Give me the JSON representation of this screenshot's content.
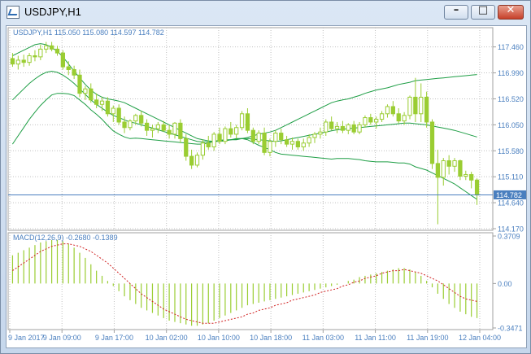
{
  "window": {
    "title": "USDJPY,H1",
    "buttons": {
      "minimize": "–",
      "maximize": "□",
      "close": "✕"
    }
  },
  "chart": {
    "info_label": "USDJPY,H1  115.050 115.080 114.597 114.782",
    "price_axis": [
      "117.460",
      "116.990",
      "116.520",
      "116.050",
      "115.580",
      "115.110",
      "114.640",
      "114.170"
    ],
    "current_price": "114.782",
    "time_axis": [
      "9 Jan 2017",
      "9 Jan 09:00",
      "9 Jan 17:00",
      "10 Jan 02:00",
      "10 Jan 10:00",
      "10 Jan 18:00",
      "11 Jan 03:00",
      "11 Jan 11:00",
      "11 Jan 19:00",
      "12 Jan 04:00"
    ],
    "macd_label": "MACD(12,26,9) -0.2680 -0.1389",
    "macd_axis": [
      "0.3709",
      "0.00",
      "-0.3471"
    ]
  },
  "colors": {
    "candle": "#9acd32",
    "bands": "#1e9e45",
    "grid": "#c0c0c0",
    "axis_text": "#4a7fbf",
    "macd_signal": "#d02020",
    "current_price_line": "#4a7fbf"
  },
  "chart_data": [
    {
      "type": "candlestick",
      "title": "USDJPY,H1",
      "ylim": [
        114.17,
        117.7
      ],
      "x": [
        "9 Jan 2017",
        "9 Jan 09:00",
        "9 Jan 17:00",
        "10 Jan 02:00",
        "10 Jan 10:00",
        "10 Jan 18:00",
        "11 Jan 03:00",
        "11 Jan 11:00",
        "11 Jan 19:00",
        "12 Jan 04:00"
      ],
      "ohlc": [
        [
          117.25,
          117.35,
          117.1,
          117.15
        ],
        [
          117.15,
          117.3,
          117.05,
          117.22
        ],
        [
          117.22,
          117.32,
          117.1,
          117.18
        ],
        [
          117.18,
          117.35,
          117.12,
          117.3
        ],
        [
          117.3,
          117.4,
          117.2,
          117.28
        ],
        [
          117.28,
          117.5,
          117.22,
          117.42
        ],
        [
          117.42,
          117.55,
          117.35,
          117.48
        ],
        [
          117.48,
          117.55,
          117.38,
          117.42
        ],
        [
          117.42,
          117.48,
          117.3,
          117.35
        ],
        [
          117.35,
          117.4,
          117.05,
          117.1
        ],
        [
          117.1,
          117.2,
          116.95,
          117.05
        ],
        [
          117.05,
          117.12,
          116.88,
          116.95
        ],
        [
          116.95,
          117.05,
          116.55,
          116.62
        ],
        [
          116.62,
          116.75,
          116.5,
          116.7
        ],
        [
          116.7,
          116.8,
          116.45,
          116.5
        ],
        [
          116.5,
          116.62,
          116.35,
          116.42
        ],
        [
          116.42,
          116.55,
          116.3,
          116.48
        ],
        [
          116.48,
          116.55,
          116.2,
          116.25
        ],
        [
          116.25,
          116.4,
          116.1,
          116.35
        ],
        [
          116.35,
          116.42,
          116.05,
          116.1
        ],
        [
          116.1,
          116.2,
          115.9,
          116.0
        ],
        [
          116.0,
          116.15,
          115.95,
          116.12
        ],
        [
          116.12,
          116.25,
          116.05,
          116.22
        ],
        [
          116.22,
          116.3,
          116.02,
          116.08
        ],
        [
          116.08,
          116.15,
          115.85,
          115.95
        ],
        [
          115.95,
          116.05,
          115.82,
          115.98
        ],
        [
          115.98,
          116.1,
          115.9,
          116.05
        ],
        [
          116.05,
          116.12,
          115.92,
          115.95
        ],
        [
          115.95,
          116.05,
          115.8,
          115.88
        ],
        [
          115.88,
          116.1,
          115.8,
          116.08
        ],
        [
          116.08,
          116.15,
          115.72,
          115.8
        ],
        [
          115.8,
          115.88,
          115.4,
          115.48
        ],
        [
          115.48,
          115.6,
          115.25,
          115.32
        ],
        [
          115.32,
          115.55,
          115.28,
          115.5
        ],
        [
          115.5,
          115.78,
          115.42,
          115.72
        ],
        [
          115.72,
          115.85,
          115.6,
          115.65
        ],
        [
          115.65,
          115.92,
          115.58,
          115.88
        ],
        [
          115.88,
          116.0,
          115.7,
          115.75
        ],
        [
          115.75,
          116.02,
          115.7,
          115.98
        ],
        [
          115.98,
          116.1,
          115.82,
          115.88
        ],
        [
          115.88,
          116.05,
          115.8,
          116.0
        ],
        [
          116.0,
          116.3,
          115.95,
          116.25
        ],
        [
          116.25,
          116.35,
          115.9,
          115.95
        ],
        [
          115.95,
          116.0,
          115.7,
          115.75
        ],
        [
          115.75,
          115.95,
          115.7,
          115.9
        ],
        [
          115.9,
          116.0,
          115.5,
          115.55
        ],
        [
          115.55,
          115.8,
          115.48,
          115.75
        ],
        [
          115.75,
          115.95,
          115.65,
          115.9
        ],
        [
          115.9,
          115.98,
          115.7,
          115.78
        ],
        [
          115.78,
          115.85,
          115.65,
          115.7
        ],
        [
          115.7,
          115.82,
          115.6,
          115.75
        ],
        [
          115.75,
          115.8,
          115.6,
          115.65
        ],
        [
          115.65,
          115.8,
          115.58,
          115.72
        ],
        [
          115.72,
          115.88,
          115.65,
          115.82
        ],
        [
          115.82,
          115.92,
          115.72,
          115.88
        ],
        [
          115.88,
          116.0,
          115.8,
          115.92
        ],
        [
          115.92,
          116.15,
          115.85,
          116.1
        ],
        [
          116.1,
          116.2,
          115.95,
          115.98
        ],
        [
          115.98,
          116.1,
          115.9,
          116.02
        ],
        [
          116.02,
          116.12,
          115.9,
          115.95
        ],
        [
          115.95,
          116.08,
          115.88,
          116.05
        ],
        [
          116.05,
          116.12,
          115.88,
          115.92
        ],
        [
          115.92,
          116.1,
          115.88,
          116.05
        ],
        [
          116.05,
          116.22,
          116.0,
          116.18
        ],
        [
          116.18,
          116.25,
          116.05,
          116.1
        ],
        [
          116.1,
          116.2,
          115.98,
          116.15
        ],
        [
          116.15,
          116.3,
          116.1,
          116.25
        ],
        [
          116.25,
          116.42,
          116.18,
          116.38
        ],
        [
          116.38,
          116.48,
          116.2,
          116.25
        ],
        [
          116.25,
          116.35,
          116.08,
          116.12
        ],
        [
          116.12,
          116.28,
          116.05,
          116.22
        ],
        [
          116.22,
          116.58,
          116.15,
          116.55
        ],
        [
          116.55,
          116.9,
          116.1,
          116.25
        ],
        [
          116.25,
          116.8,
          116.1,
          116.55
        ],
        [
          116.55,
          116.65,
          116.0,
          116.1
        ],
        [
          116.1,
          116.15,
          115.25,
          115.35
        ],
        [
          115.35,
          115.6,
          114.25,
          115.1
        ],
        [
          115.1,
          115.45,
          114.95,
          115.4
        ],
        [
          115.4,
          115.5,
          115.15,
          115.3
        ],
        [
          115.3,
          115.45,
          115.2,
          115.4
        ],
        [
          115.4,
          115.42,
          115.05,
          115.12
        ],
        [
          115.12,
          115.22,
          115.05,
          115.15
        ],
        [
          115.15,
          115.2,
          114.9,
          115.05
        ],
        [
          115.05,
          115.08,
          114.6,
          114.78
        ]
      ],
      "bands": {
        "upper": [
          117.3,
          117.35,
          117.4,
          117.45,
          117.5,
          117.52,
          117.5,
          117.45,
          117.38,
          117.28,
          117.15,
          117.02,
          116.9,
          116.78,
          116.68,
          116.6,
          116.55,
          116.52,
          116.5,
          116.48,
          116.45,
          116.4,
          116.35,
          116.3,
          116.25,
          116.2,
          116.15,
          116.1,
          116.05,
          116.0,
          115.95,
          115.9,
          115.85,
          115.8,
          115.78,
          115.76,
          115.75,
          115.75,
          115.76,
          115.78,
          115.8,
          115.8,
          115.82,
          115.85,
          115.88,
          115.9,
          115.92,
          115.95,
          116.0,
          116.05,
          116.1,
          116.15,
          116.2,
          116.25,
          116.3,
          116.35,
          116.4,
          116.45,
          116.48,
          116.5,
          116.52,
          116.55,
          116.58,
          116.62,
          116.65,
          116.68,
          116.7,
          116.72,
          116.75,
          116.78,
          116.8,
          116.82,
          116.85,
          116.86,
          116.87,
          116.88,
          116.89,
          116.9,
          116.91,
          116.92,
          116.93,
          116.94,
          116.95,
          116.96
        ],
        "middle": [
          116.5,
          116.6,
          116.7,
          116.8,
          116.88,
          116.95,
          117.0,
          117.02,
          117.0,
          116.95,
          116.88,
          116.8,
          116.7,
          116.6,
          116.5,
          116.42,
          116.35,
          116.28,
          116.22,
          116.18,
          116.14,
          116.1,
          116.08,
          116.05,
          116.02,
          115.99,
          115.96,
          115.93,
          115.9,
          115.87,
          115.84,
          115.81,
          115.78,
          115.75,
          115.74,
          115.74,
          115.75,
          115.76,
          115.77,
          115.78,
          115.79,
          115.8,
          115.8,
          115.79,
          115.78,
          115.77,
          115.76,
          115.75,
          115.76,
          115.78,
          115.8,
          115.82,
          115.84,
          115.86,
          115.88,
          115.9,
          115.92,
          115.94,
          115.96,
          115.97,
          115.98,
          115.99,
          116.0,
          116.01,
          116.02,
          116.03,
          116.04,
          116.05,
          116.06,
          116.07,
          116.08,
          116.08,
          116.07,
          116.06,
          116.05,
          116.03,
          116.01,
          115.99,
          115.97,
          115.95,
          115.92,
          115.89,
          115.86,
          115.83
        ],
        "lower": [
          115.7,
          115.85,
          116.0,
          116.15,
          116.28,
          116.4,
          116.5,
          116.59,
          116.62,
          116.62,
          116.61,
          116.58,
          116.5,
          116.42,
          116.32,
          116.24,
          116.15,
          116.04,
          115.94,
          115.88,
          115.83,
          115.8,
          115.81,
          115.8,
          115.79,
          115.78,
          115.77,
          115.76,
          115.75,
          115.74,
          115.73,
          115.72,
          115.71,
          115.7,
          115.7,
          115.72,
          115.75,
          115.77,
          115.78,
          115.78,
          115.78,
          115.8,
          115.78,
          115.73,
          115.68,
          115.64,
          115.6,
          115.55,
          115.52,
          115.51,
          115.5,
          115.49,
          115.48,
          115.47,
          115.46,
          115.45,
          115.44,
          115.43,
          115.44,
          115.44,
          115.44,
          115.43,
          115.42,
          115.4,
          115.39,
          115.38,
          115.38,
          115.38,
          115.37,
          115.36,
          115.36,
          115.34,
          115.29,
          115.26,
          115.23,
          115.18,
          115.13,
          115.08,
          115.03,
          114.98,
          114.91,
          114.84,
          114.77,
          114.7
        ]
      }
    },
    {
      "type": "bar",
      "title": "MACD(12,26,9) -0.2680 -0.1389",
      "ylim": [
        -0.3471,
        0.3709
      ],
      "series": [
        {
          "name": "MACD",
          "values": [
            0.22,
            0.24,
            0.26,
            0.28,
            0.3,
            0.32,
            0.33,
            0.34,
            0.34,
            0.33,
            0.31,
            0.28,
            0.24,
            0.2,
            0.15,
            0.1,
            0.06,
            0.02,
            -0.02,
            -0.06,
            -0.1,
            -0.13,
            -0.16,
            -0.19,
            -0.21,
            -0.23,
            -0.25,
            -0.27,
            -0.29,
            -0.3,
            -0.31,
            -0.32,
            -0.33,
            -0.33,
            -0.32,
            -0.31,
            -0.29,
            -0.27,
            -0.25,
            -0.23,
            -0.21,
            -0.19,
            -0.17,
            -0.16,
            -0.15,
            -0.14,
            -0.13,
            -0.12,
            -0.11,
            -0.1,
            -0.09,
            -0.08,
            -0.07,
            -0.06,
            -0.05,
            -0.04,
            -0.03,
            -0.02,
            -0.01,
            0.0,
            0.02,
            0.03,
            0.05,
            0.06,
            0.07,
            0.08,
            0.09,
            0.1,
            0.11,
            0.12,
            0.12,
            0.11,
            0.09,
            0.06,
            0.02,
            -0.03,
            -0.08,
            -0.12,
            -0.16,
            -0.19,
            -0.22,
            -0.24,
            -0.26,
            -0.27
          ]
        },
        {
          "name": "Signal",
          "values": [
            0.1,
            0.13,
            0.16,
            0.19,
            0.22,
            0.25,
            0.27,
            0.29,
            0.3,
            0.31,
            0.31,
            0.3,
            0.29,
            0.27,
            0.25,
            0.22,
            0.19,
            0.16,
            0.12,
            0.08,
            0.04,
            0.0,
            -0.04,
            -0.08,
            -0.11,
            -0.14,
            -0.17,
            -0.2,
            -0.22,
            -0.24,
            -0.26,
            -0.28,
            -0.29,
            -0.3,
            -0.31,
            -0.31,
            -0.31,
            -0.3,
            -0.29,
            -0.28,
            -0.27,
            -0.26,
            -0.24,
            -0.23,
            -0.21,
            -0.2,
            -0.19,
            -0.17,
            -0.16,
            -0.15,
            -0.13,
            -0.12,
            -0.11,
            -0.1,
            -0.09,
            -0.07,
            -0.06,
            -0.05,
            -0.04,
            -0.02,
            -0.01,
            0.01,
            0.02,
            0.04,
            0.05,
            0.06,
            0.08,
            0.09,
            0.1,
            0.1,
            0.11,
            0.1,
            0.09,
            0.08,
            0.06,
            0.04,
            0.02,
            -0.01,
            -0.04,
            -0.07,
            -0.1,
            -0.12,
            -0.13,
            -0.14
          ]
        }
      ]
    }
  ]
}
